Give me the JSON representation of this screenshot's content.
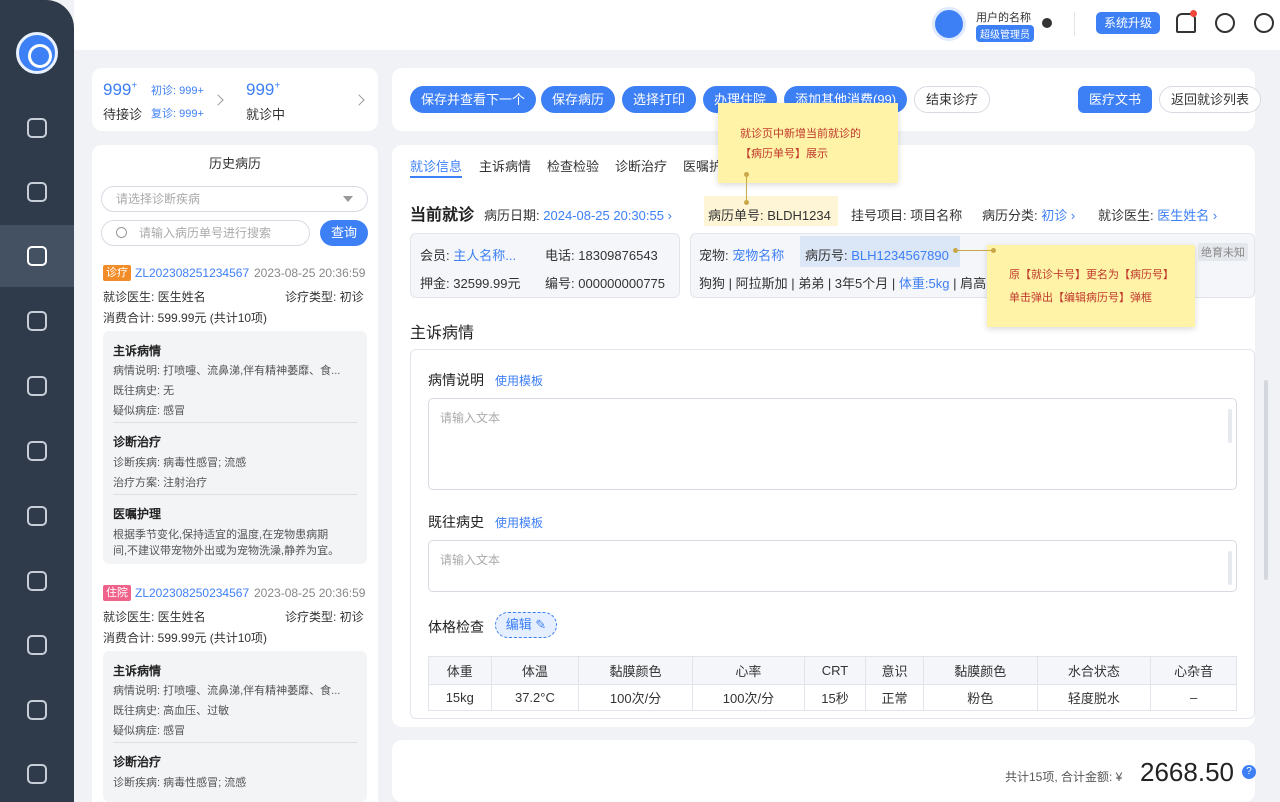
{
  "user": {
    "name": "用户的名称",
    "role": "超级管理员"
  },
  "topbar": {
    "upgrade_label": "系统升级"
  },
  "stats": {
    "waiting_count": "999",
    "waiting_plus": "+",
    "waiting_label": "待接诊",
    "first_visit_label": "初诊:",
    "first_visit_value": "999+",
    "revisit_label": "复诊:",
    "revisit_value": "999+",
    "in_progress_count": "999",
    "in_progress_plus": "+",
    "in_progress_label": "就诊中"
  },
  "toolbar": {
    "save_next": "保存并查看下一个",
    "save_record": "保存病历",
    "select_print": "选择打印",
    "admit": "办理住院",
    "add_other": "添加其他消费(99)",
    "end_visit": "结束诊疗",
    "medical_doc": "医疗文书",
    "back_list": "返回就诊列表"
  },
  "history": {
    "title": "历史病历",
    "disease_placeholder": "请选择诊断疾病",
    "search_placeholder": "请输入病历单号进行搜索",
    "query_label": "查询",
    "records": [
      {
        "tag": "诊疗",
        "tag_color": "#f28c28",
        "id": "ZL202308251234567",
        "time": "2023-08-25 20:36:59",
        "doctor": "就诊医生:  医生姓名",
        "visit_type": "诊疗类型:  初诊",
        "cost": "消费合计:  599.99元 (共计10项)",
        "s1_title": "主诉病情",
        "s1_l1": "病情说明: 打喷嚏、流鼻涕,伴有精神萎靡、食...",
        "s1_l2": "既往病史: 无",
        "s1_l3": "疑似病症: 感冒",
        "s2_title": "诊断治疗",
        "s2_l1": "诊断疾病: 病毒性感冒; 流感",
        "s2_l2": "治疗方案: 注射治疗",
        "s3_title": "医嘱护理",
        "s3_l1": "根据季节变化,保持适宜的温度,在宠物患病期",
        "s3_l2": "间,不建议带宠物外出或为宠物洗澡,静养为宜。"
      },
      {
        "tag": "住院",
        "tag_color": "#f0628a",
        "id": "ZL202308250234567",
        "time": "2023-08-25 20:36:59",
        "doctor": "就诊医生:  医生姓名",
        "visit_type": "诊疗类型:  初诊",
        "cost": "消费合计:  599.99元 (共计10项)",
        "s1_title": "主诉病情",
        "s1_l1": "病情说明: 打喷嚏、流鼻涕,伴有精神萎靡、食...",
        "s1_l2": "既往病史: 高血压、过敏",
        "s1_l3": "疑似病症: 感冒",
        "s2_title": "诊断治疗",
        "s2_l1": "诊断疾病: 病毒性感冒; 流感"
      }
    ]
  },
  "tabs": [
    "就诊信息",
    "主诉病情",
    "检查检验",
    "诊断治疗",
    "医嘱护"
  ],
  "current": {
    "title": "当前就诊",
    "date_label": "病历日期:",
    "date_value": "2024-08-25 20:30:55",
    "record_no_label": "病历单号:",
    "record_no_value": "BLDH1234",
    "project_label": "挂号项目:",
    "project_value": "项目名称",
    "category_label": "病历分类:",
    "category_value": "初诊",
    "doctor_label": "就诊医生:",
    "doctor_value": "医生姓名"
  },
  "member": {
    "member_label": "会员:",
    "member_value": "主人名称...",
    "phone_label": "电话:",
    "phone_value": "18309876543",
    "deposit_label": "押金:",
    "deposit_value": "32599.99元",
    "code_label": "编号:",
    "code_value": "000000000775"
  },
  "pet": {
    "pet_label": "宠物:",
    "pet_value": "宠物名称",
    "case_label": "病历号:",
    "case_value": "BLH1234567890",
    "sterile_tag": "绝育未知",
    "details": "狗狗 | 阿拉斯加 | 弟弟 | 3年5个月 |",
    "weight": "体重:5kg",
    "extra": "| 肩高"
  },
  "notes": {
    "note1_l1": "就诊页中新增当前就诊的",
    "note1_l2": "【病历单号】展示",
    "note2_l1": "原【就诊卡号】更名为【病历号】",
    "note2_l2": "单击弹出【编辑病历号】弹框"
  },
  "complaint": {
    "section_title": "主诉病情",
    "desc_label": "病情说明",
    "history_label": "既往病史",
    "template_label": "使用模板",
    "placeholder": "请输入文本",
    "exam_label": "体格检查",
    "edit_label": "编辑 ✎"
  },
  "exam_table": {
    "headers": [
      "体重",
      "体温",
      "黏膜颜色",
      "心率",
      "CRT",
      "意识",
      "黏膜颜色",
      "水合状态",
      "心杂音"
    ],
    "rows": [
      [
        "15kg",
        "37.2°C",
        "100次/分",
        "100次/分",
        "15秒",
        "正常",
        "粉色",
        "轻度脱水",
        "–"
      ]
    ]
  },
  "footer": {
    "total_text": "共计15项, 合计金额: ¥",
    "total_amount": "2668.50",
    "help": "?"
  },
  "colors": {
    "primary": "#3d7ff5",
    "sidebar": "#2f3a4a",
    "note_bg": "#fff3a8"
  }
}
